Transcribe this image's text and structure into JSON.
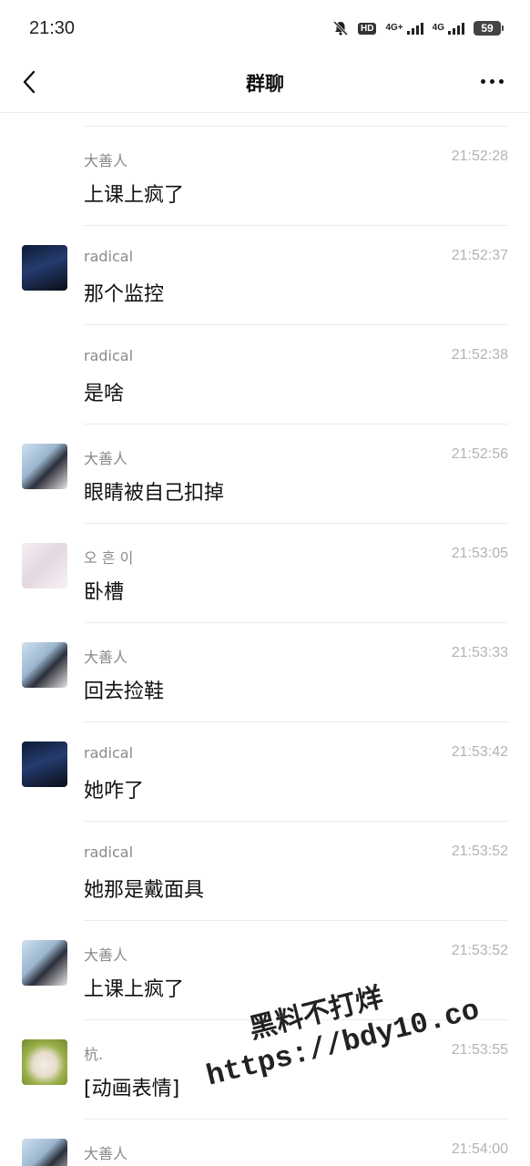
{
  "status_bar": {
    "time": "21:30",
    "hd_label": "HD",
    "net1": "4G+",
    "net2": "4G",
    "battery": "59"
  },
  "header": {
    "title": "群聊"
  },
  "messages": [
    {
      "sender": "大善人",
      "time": "21:52:28",
      "text": "上课上疯了",
      "avatar": "none"
    },
    {
      "sender": "radical",
      "time": "21:52:37",
      "text": "那个监控",
      "avatar": "dark-night-photo"
    },
    {
      "sender": "radical",
      "time": "21:52:38",
      "text": "是啥",
      "avatar": "none"
    },
    {
      "sender": "大善人",
      "time": "21:52:56",
      "text": "眼睛被自己扣掉",
      "avatar": "anime-character"
    },
    {
      "sender": "오 흔 이",
      "time": "21:53:05",
      "text": "卧槽",
      "avatar": "pale-anime-character"
    },
    {
      "sender": "大善人",
      "time": "21:53:33",
      "text": "回去捡鞋",
      "avatar": "anime-character"
    },
    {
      "sender": "radical",
      "time": "21:53:42",
      "text": "她咋了",
      "avatar": "dark-night-photo"
    },
    {
      "sender": "radical",
      "time": "21:53:52",
      "text": "她那是戴面具",
      "avatar": "none"
    },
    {
      "sender": "大善人",
      "time": "21:53:52",
      "text": "上课上疯了",
      "avatar": "anime-character"
    },
    {
      "sender": "杭.",
      "time": "21:53:55",
      "text": "[动画表情]",
      "avatar": "dog-photo"
    },
    {
      "sender": "大善人",
      "time": "21:54:00",
      "text": "",
      "avatar": "anime-character"
    }
  ],
  "watermark": {
    "line1": "黑料不打烊",
    "line2": "https://bdy10.co"
  }
}
